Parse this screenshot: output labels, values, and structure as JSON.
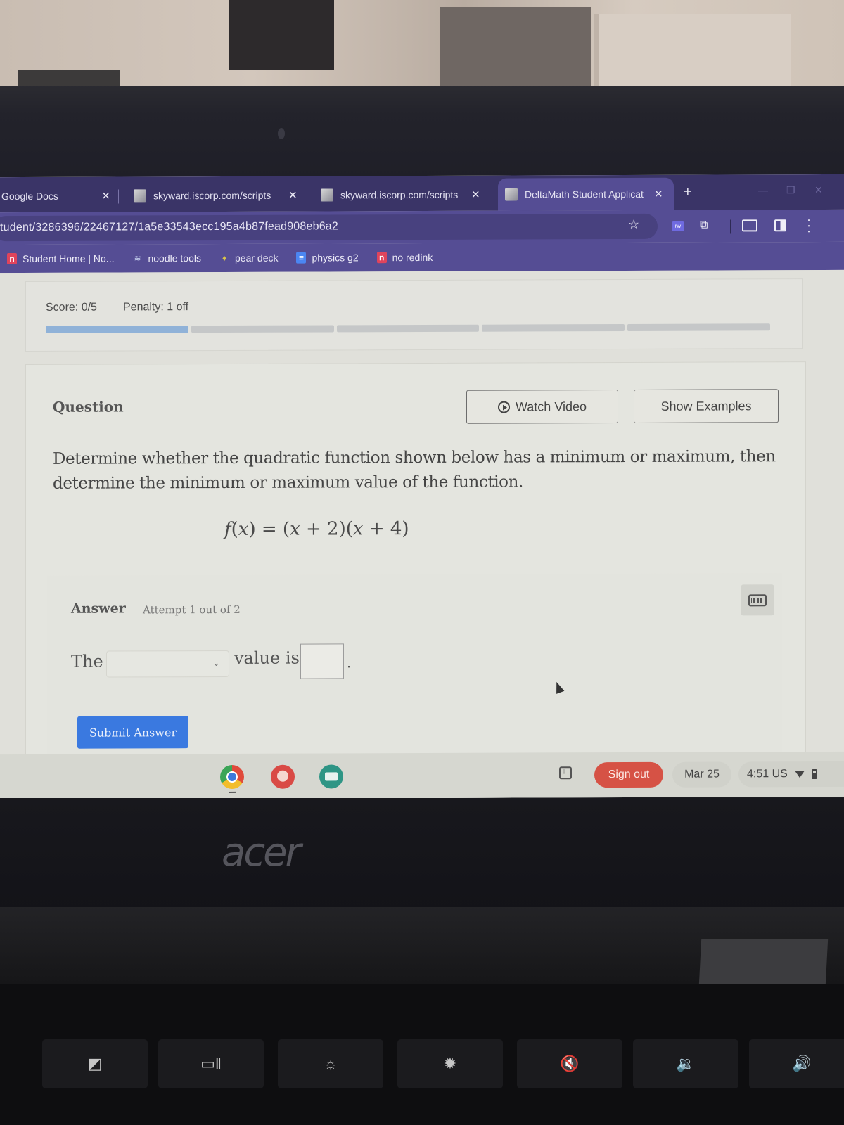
{
  "browser": {
    "tabs": [
      {
        "title": "Google Docs",
        "active": false
      },
      {
        "title": "skyward.iscorp.com/scripts",
        "active": false
      },
      {
        "title": "skyward.iscorp.com/scripts",
        "active": false
      },
      {
        "title": "DeltaMath Student Application",
        "active": true
      }
    ],
    "tab_close_glyph": "✕",
    "new_tab_glyph": "+",
    "url": "tudent/3286396/22467127/1a5e33543ecc195a4b87fead908eb6a2",
    "extension_badge": "rw",
    "bookmarks": [
      {
        "label": "Student Home | No...",
        "icon": "noredink-icon"
      },
      {
        "label": "noodle tools",
        "icon": "noodletools-icon"
      },
      {
        "label": "pear deck",
        "icon": "peardeck-icon"
      },
      {
        "label": "physics g2",
        "icon": "google-doc-icon"
      },
      {
        "label": "no redink",
        "icon": "noredink-icon"
      }
    ]
  },
  "score": {
    "score_text": "Score: 0/5",
    "penalty_text": "Penalty: 1 off",
    "progress_segments_total": 5,
    "progress_segments_filled": 1
  },
  "question": {
    "heading": "Question",
    "watch_video_label": "Watch Video",
    "show_examples_label": "Show Examples",
    "prompt": "Determine whether the quadratic function shown below has a minimum or maximum, then determine the minimum or maximum value of the function.",
    "formula": {
      "fn": "f",
      "var": "x",
      "expression": "f(x) = (x + 2)(x + 4)"
    }
  },
  "answer": {
    "heading": "Answer",
    "attempt_text": "Attempt 1 out of 2",
    "sentence_start": "The",
    "select_value": "",
    "sentence_mid": "value is",
    "value_input": "",
    "sentence_end": ".",
    "submit_label": "Submit Answer"
  },
  "shelf": {
    "apps": [
      "chrome-icon",
      "canvas-icon",
      "classroom-icon"
    ],
    "sign_out_label": "Sign out",
    "date": "Mar 25",
    "time": "4:51",
    "locale": "US"
  },
  "hardware": {
    "brand": "acer"
  },
  "colors": {
    "browser_frame": "#3a3467",
    "browser_toolbar": "#554d94",
    "submit_button": "#3a79e0",
    "sign_out": "#d65245",
    "progress_fill": "#90b2d8"
  }
}
